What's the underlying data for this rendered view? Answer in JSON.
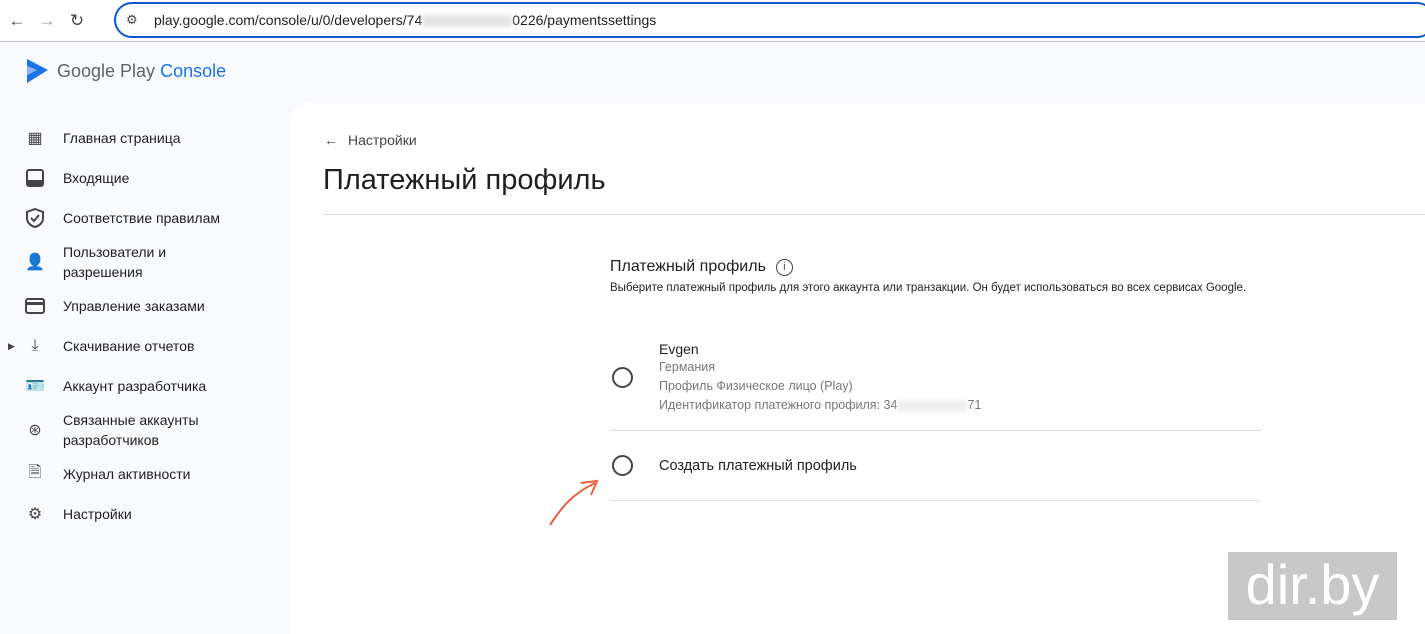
{
  "browser": {
    "url_prefix": "play.google.com/console/u/0/developers/74",
    "url_suffix": "0226/paymentssettings"
  },
  "logo": {
    "google_play": "Google Play",
    "console": "Console"
  },
  "sidebar": {
    "items": [
      {
        "label": "Главная страница",
        "icon": "dashboard-icon"
      },
      {
        "label": "Входящие",
        "icon": "inbox-icon"
      },
      {
        "label": "Соответствие правилам",
        "icon": "shield-icon"
      },
      {
        "label": "Пользователи и разрешения",
        "icon": "users-icon"
      },
      {
        "label": "Управление заказами",
        "icon": "credit-card-icon"
      },
      {
        "label": "Скачивание отчетов",
        "icon": "download-icon"
      },
      {
        "label": "Аккаунт разработчика",
        "icon": "badge-icon"
      },
      {
        "label": "Связанные аккаунты разработчиков",
        "icon": "linked-accounts-icon"
      },
      {
        "label": "Журнал активности",
        "icon": "document-icon"
      },
      {
        "label": "Настройки",
        "icon": "gear-icon"
      }
    ]
  },
  "main": {
    "back_label": "Настройки",
    "title": "Платежный профиль",
    "section_title": "Платежный профиль",
    "section_desc": "Выберите платежный профиль для этого аккаунта или транзакции. Он будет использоваться во всех сервисах Google.",
    "profile": {
      "name": "Evgen",
      "country": "Германия",
      "type": "Профиль Физическое лицо (Play)",
      "id_label": "Идентификатор платежного профиля: 34",
      "id_suffix": "71"
    },
    "create_label": "Создать платежный профиль"
  },
  "watermark": "dir.by"
}
